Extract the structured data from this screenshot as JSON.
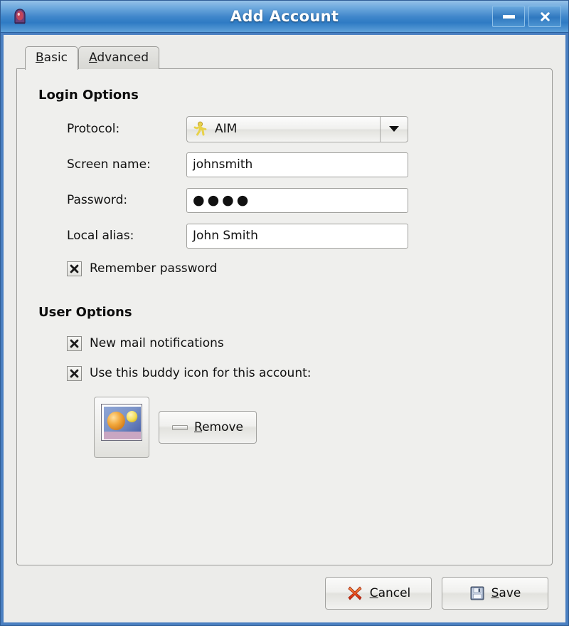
{
  "window": {
    "title": "Add Account",
    "icon": "pidgin-app-icon",
    "minimize_label": "—",
    "close_label": "✖"
  },
  "tabs": [
    {
      "label": "Basic",
      "mnemonic": "B",
      "active": true,
      "name": "tab-basic"
    },
    {
      "label": "Advanced",
      "mnemonic": "A",
      "active": false,
      "name": "tab-advanced"
    }
  ],
  "login_options": {
    "heading": "Login Options",
    "protocol": {
      "label": "Protocol:",
      "value": "AIM",
      "icon": "aim-running-man-icon",
      "options": [
        "AIM"
      ]
    },
    "screen_name": {
      "label": "Screen name:",
      "value": "johnsmith",
      "placeholder": ""
    },
    "password": {
      "label": "Password:",
      "value": "●●●●",
      "placeholder": ""
    },
    "local_alias": {
      "label": "Local alias:",
      "value": "John Smith",
      "placeholder": ""
    },
    "remember_password": {
      "label": "Remember password",
      "checked": true,
      "mark": "✖"
    }
  },
  "user_options": {
    "heading": "User Options",
    "new_mail_notifications": {
      "label": "New mail notifications",
      "checked": true,
      "mark": "✖"
    },
    "use_buddy_icon": {
      "label": "Use this buddy icon for this account:",
      "checked": true,
      "mark": "✖"
    },
    "buddy_icon_preview": "buddy-icon-image",
    "remove_button": {
      "label": "Remove",
      "mnemonic": "R",
      "icon": "minus-dash-icon"
    }
  },
  "actions": {
    "cancel": {
      "label": "Cancel",
      "mnemonic": "C",
      "icon": "red-x-icon"
    },
    "save": {
      "label": "Save",
      "mnemonic": "S",
      "icon": "floppy-disk-icon"
    }
  },
  "colors": {
    "titlebar_blue": "#3f86ca",
    "window_border": "#4a7fc1",
    "dialog_bg": "#ececea",
    "panel_bg": "#efefed",
    "aim_yellow": "#e8cf4e",
    "cancel_red": "#e04522",
    "save_blue": "#5b7fb0"
  }
}
